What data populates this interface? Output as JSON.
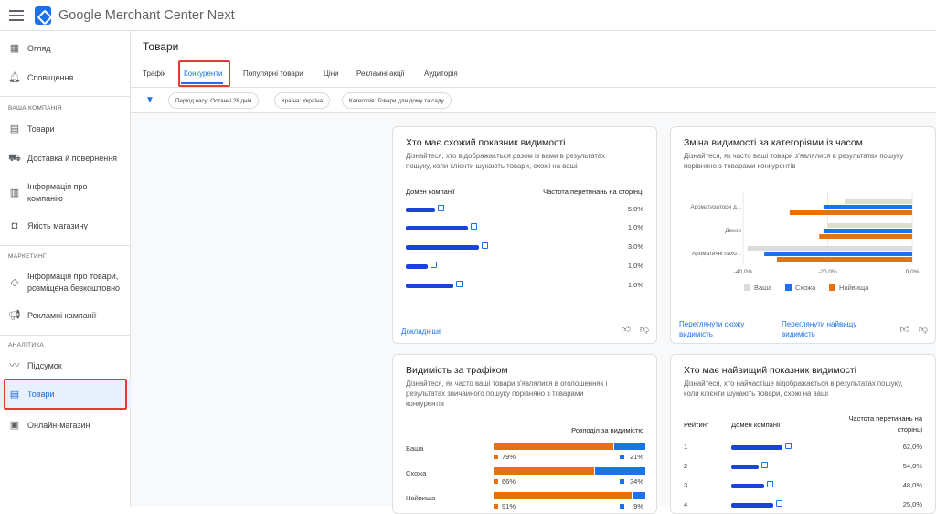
{
  "app": {
    "title": "Google Merchant Center Next"
  },
  "sidebar": {
    "items": [
      {
        "label": "Огляд"
      },
      {
        "label": "Сповіщення"
      },
      {
        "label": "Товари"
      },
      {
        "label": "Доставка й повернення"
      },
      {
        "label": "Інформація про компанію"
      },
      {
        "label": "Якість магазину"
      },
      {
        "label": "Інформація про товари, розміщена безкоштовно"
      },
      {
        "label": "Рекламні кампанії"
      },
      {
        "label": "Підсумок"
      },
      {
        "label": "Товари"
      },
      {
        "label": "Онлайн-магазин"
      }
    ],
    "sections": {
      "company": "ВАША КОМПАНІЯ",
      "marketing": "МАРКЕТИНГ",
      "analytics": "АНАЛІТИКА"
    }
  },
  "page": {
    "title": "Товари"
  },
  "tabs": [
    {
      "label": "Трафік"
    },
    {
      "label": "Конкуренти"
    },
    {
      "label": "Популярні товари"
    },
    {
      "label": "Ціни"
    },
    {
      "label": "Рекламні акції"
    },
    {
      "label": "Аудиторія"
    }
  ],
  "filters": {
    "period": "Період часу: Останні 28 днів",
    "country": "Країна: Україна",
    "category": "Категорія: Товари для дому та саду"
  },
  "card1": {
    "title": "Хто має схожий показник видимості",
    "subtitle_line1": "Дізнайтеся, хто відображається разом із вами в результатах",
    "subtitle_line2": "пошуку, коли клієнти шукають товари, схожі на ваші",
    "col_domain": "Домен компанії",
    "col_overlap": "Частота перетинань на сторінці",
    "rows": [
      {
        "value": "5,0%"
      },
      {
        "value": "1,0%"
      },
      {
        "value": "3,0%"
      },
      {
        "value": "1,0%"
      },
      {
        "value": "1,0%"
      }
    ],
    "more_link": "Докладніше"
  },
  "card2": {
    "title": "Зміна видимості за категоріями із часом",
    "subtitle_line1": "Дізнайтеся, як часто ваші товари з'являлися в результатах пошуку",
    "subtitle_line2": "порівняно з товарами конкурентів",
    "link1_line1": "Переглянути схожу",
    "link1_line2": "видимість",
    "link2_line1": "Переглянути найвищу",
    "link2_line2": "видимість"
  },
  "chart_data": {
    "type": "bar",
    "orientation": "horizontal",
    "categories": [
      "Ароматизатори д...",
      "Декор",
      "Ароматичні пахо..."
    ],
    "series": [
      {
        "name": "Ваша",
        "color": "#dadce0",
        "values": [
          -16,
          -20,
          -39
        ]
      },
      {
        "name": "Схожа",
        "color": "#1a73e8",
        "values": [
          -21,
          -21,
          -35
        ]
      },
      {
        "name": "Найвища",
        "color": "#e8710a",
        "values": [
          -29,
          -22,
          -32
        ]
      }
    ],
    "xticks": [
      "-40,0%",
      "-20,0%",
      "0,0%"
    ],
    "xlim": [
      -40,
      0
    ],
    "legend": "bottom",
    "grid": true
  },
  "card3": {
    "title": "Видимість за трафіком",
    "subtitle_line1": "Дізнайтеся, як часто ваші товари з'являлися в оголошеннях і",
    "subtitle_line2": "результатах звичайного пошуку порівняно з товарами",
    "subtitle_line3": "конкурентів",
    "header": "Розподіл за видимістю",
    "rows": [
      {
        "label": "Ваша",
        "orange": 79,
        "blue": 21,
        "orange_label": "79%",
        "blue_label": "21%"
      },
      {
        "label": "Схожа",
        "orange": 66,
        "blue": 34,
        "orange_label": "66%",
        "blue_label": "34%"
      },
      {
        "label": "Найвища",
        "orange": 91,
        "blue": 9,
        "orange_label": "91%",
        "blue_label": "9%"
      }
    ]
  },
  "card4": {
    "title": "Хто має найвищий показник видимості",
    "subtitle_line1": "Дізнайтеся, хто найчастіше відображається в результатах пошуку,",
    "subtitle_line2": "коли клієнти шукають товари, схожі на ваші",
    "col_rank": "Рейтинг",
    "col_domain": "Домен компанії",
    "col_overlap_line1": "Частота перетинань на",
    "col_overlap_line2": "сторінці",
    "rows": [
      {
        "rank": "1",
        "value": "62,0%"
      },
      {
        "rank": "2",
        "value": "54,0%"
      },
      {
        "rank": "3",
        "value": "48,0%"
      },
      {
        "rank": "4",
        "value": "25,0%"
      }
    ]
  },
  "colors": {
    "accent": "#1a73e8",
    "orange": "#e8710a",
    "highlight": "#e53935"
  }
}
